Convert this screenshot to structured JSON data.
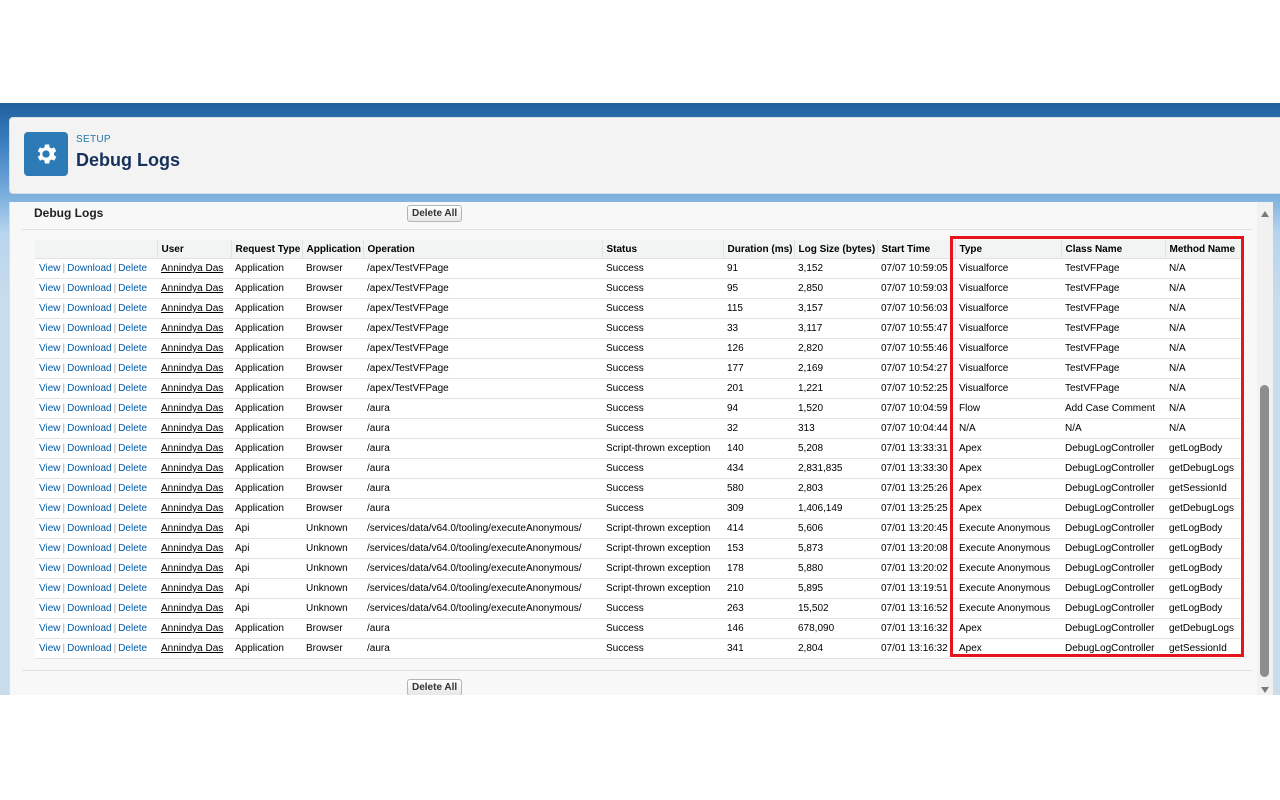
{
  "header": {
    "eyebrow": "SETUP",
    "title": "Debug Logs",
    "icon": "gear-icon"
  },
  "section": {
    "title": "Debug Logs",
    "delete_all_label": "Delete All"
  },
  "table": {
    "columns": [
      "",
      "User",
      "Request Type",
      "Application",
      "Operation",
      "Status",
      "Duration (ms)",
      "Log Size (bytes)",
      "Start Time",
      "Type",
      "Class Name",
      "Method Name"
    ],
    "action_labels": {
      "view": "View",
      "download": "Download",
      "delete": "Delete",
      "separator": "|"
    },
    "rows": [
      {
        "user": "Annindya Das",
        "request_type": "Application",
        "application": "Browser",
        "operation": "/apex/TestVFPage",
        "status": "Success",
        "duration": "91",
        "log_size": "3,152",
        "start_time": "07/07 10:59:05",
        "type": "Visualforce",
        "class_name": "TestVFPage",
        "method_name": "N/A"
      },
      {
        "user": "Annindya Das",
        "request_type": "Application",
        "application": "Browser",
        "operation": "/apex/TestVFPage",
        "status": "Success",
        "duration": "95",
        "log_size": "2,850",
        "start_time": "07/07 10:59:03",
        "type": "Visualforce",
        "class_name": "TestVFPage",
        "method_name": "N/A"
      },
      {
        "user": "Annindya Das",
        "request_type": "Application",
        "application": "Browser",
        "operation": "/apex/TestVFPage",
        "status": "Success",
        "duration": "115",
        "log_size": "3,157",
        "start_time": "07/07 10:56:03",
        "type": "Visualforce",
        "class_name": "TestVFPage",
        "method_name": "N/A"
      },
      {
        "user": "Annindya Das",
        "request_type": "Application",
        "application": "Browser",
        "operation": "/apex/TestVFPage",
        "status": "Success",
        "duration": "33",
        "log_size": "3,117",
        "start_time": "07/07 10:55:47",
        "type": "Visualforce",
        "class_name": "TestVFPage",
        "method_name": "N/A"
      },
      {
        "user": "Annindya Das",
        "request_type": "Application",
        "application": "Browser",
        "operation": "/apex/TestVFPage",
        "status": "Success",
        "duration": "126",
        "log_size": "2,820",
        "start_time": "07/07 10:55:46",
        "type": "Visualforce",
        "class_name": "TestVFPage",
        "method_name": "N/A"
      },
      {
        "user": "Annindya Das",
        "request_type": "Application",
        "application": "Browser",
        "operation": "/apex/TestVFPage",
        "status": "Success",
        "duration": "177",
        "log_size": "2,169",
        "start_time": "07/07 10:54:27",
        "type": "Visualforce",
        "class_name": "TestVFPage",
        "method_name": "N/A"
      },
      {
        "user": "Annindya Das",
        "request_type": "Application",
        "application": "Browser",
        "operation": "/apex/TestVFPage",
        "status": "Success",
        "duration": "201",
        "log_size": "1,221",
        "start_time": "07/07 10:52:25",
        "type": "Visualforce",
        "class_name": "TestVFPage",
        "method_name": "N/A"
      },
      {
        "user": "Annindya Das",
        "request_type": "Application",
        "application": "Browser",
        "operation": "/aura",
        "status": "Success",
        "duration": "94",
        "log_size": "1,520",
        "start_time": "07/07 10:04:59",
        "type": "Flow",
        "class_name": "Add Case Comment",
        "method_name": "N/A"
      },
      {
        "user": "Annindya Das",
        "request_type": "Application",
        "application": "Browser",
        "operation": "/aura",
        "status": "Success",
        "duration": "32",
        "log_size": "313",
        "start_time": "07/07 10:04:44",
        "type": "N/A",
        "class_name": "N/A",
        "method_name": "N/A"
      },
      {
        "user": "Annindya Das",
        "request_type": "Application",
        "application": "Browser",
        "operation": "/aura",
        "status": "Script-thrown exception",
        "duration": "140",
        "log_size": "5,208",
        "start_time": "07/01 13:33:31",
        "type": "Apex",
        "class_name": "DebugLogController",
        "method_name": "getLogBody"
      },
      {
        "user": "Annindya Das",
        "request_type": "Application",
        "application": "Browser",
        "operation": "/aura",
        "status": "Success",
        "duration": "434",
        "log_size": "2,831,835",
        "start_time": "07/01 13:33:30",
        "type": "Apex",
        "class_name": "DebugLogController",
        "method_name": "getDebugLogs"
      },
      {
        "user": "Annindya Das",
        "request_type": "Application",
        "application": "Browser",
        "operation": "/aura",
        "status": "Success",
        "duration": "580",
        "log_size": "2,803",
        "start_time": "07/01 13:25:26",
        "type": "Apex",
        "class_name": "DebugLogController",
        "method_name": "getSessionId"
      },
      {
        "user": "Annindya Das",
        "request_type": "Application",
        "application": "Browser",
        "operation": "/aura",
        "status": "Success",
        "duration": "309",
        "log_size": "1,406,149",
        "start_time": "07/01 13:25:25",
        "type": "Apex",
        "class_name": "DebugLogController",
        "method_name": "getDebugLogs"
      },
      {
        "user": "Annindya Das",
        "request_type": "Api",
        "application": "Unknown",
        "operation": "/services/data/v64.0/tooling/executeAnonymous/",
        "status": "Script-thrown exception",
        "duration": "414",
        "log_size": "5,606",
        "start_time": "07/01 13:20:45",
        "type": "Execute Anonymous",
        "class_name": "DebugLogController",
        "method_name": "getLogBody"
      },
      {
        "user": "Annindya Das",
        "request_type": "Api",
        "application": "Unknown",
        "operation": "/services/data/v64.0/tooling/executeAnonymous/",
        "status": "Script-thrown exception",
        "duration": "153",
        "log_size": "5,873",
        "start_time": "07/01 13:20:08",
        "type": "Execute Anonymous",
        "class_name": "DebugLogController",
        "method_name": "getLogBody"
      },
      {
        "user": "Annindya Das",
        "request_type": "Api",
        "application": "Unknown",
        "operation": "/services/data/v64.0/tooling/executeAnonymous/",
        "status": "Script-thrown exception",
        "duration": "178",
        "log_size": "5,880",
        "start_time": "07/01 13:20:02",
        "type": "Execute Anonymous",
        "class_name": "DebugLogController",
        "method_name": "getLogBody"
      },
      {
        "user": "Annindya Das",
        "request_type": "Api",
        "application": "Unknown",
        "operation": "/services/data/v64.0/tooling/executeAnonymous/",
        "status": "Script-thrown exception",
        "duration": "210",
        "log_size": "5,895",
        "start_time": "07/01 13:19:51",
        "type": "Execute Anonymous",
        "class_name": "DebugLogController",
        "method_name": "getLogBody"
      },
      {
        "user": "Annindya Das",
        "request_type": "Api",
        "application": "Unknown",
        "operation": "/services/data/v64.0/tooling/executeAnonymous/",
        "status": "Success",
        "duration": "263",
        "log_size": "15,502",
        "start_time": "07/01 13:16:52",
        "type": "Execute Anonymous",
        "class_name": "DebugLogController",
        "method_name": "getLogBody"
      },
      {
        "user": "Annindya Das",
        "request_type": "Application",
        "application": "Browser",
        "operation": "/aura",
        "status": "Success",
        "duration": "146",
        "log_size": "678,090",
        "start_time": "07/01 13:16:32",
        "type": "Apex",
        "class_name": "DebugLogController",
        "method_name": "getDebugLogs"
      },
      {
        "user": "Annindya Das",
        "request_type": "Application",
        "application": "Browser",
        "operation": "/aura",
        "status": "Success",
        "duration": "341",
        "log_size": "2,804",
        "start_time": "07/01 13:16:32",
        "type": "Apex",
        "class_name": "DebugLogController",
        "method_name": "getSessionId"
      }
    ]
  },
  "colors": {
    "brand_blue": "#2c7bb6",
    "link_blue": "#015ba7",
    "highlight_red": "#e8141c"
  }
}
